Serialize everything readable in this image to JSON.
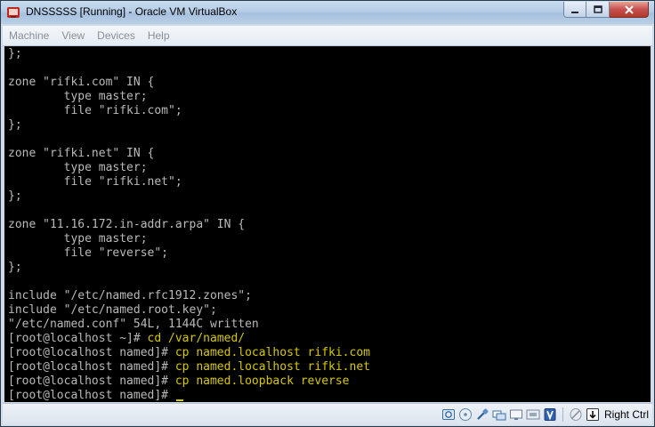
{
  "window": {
    "title": "DNSSSSS [Running] - Oracle VM VirtualBox"
  },
  "menu": {
    "items": [
      "Machine",
      "View",
      "Devices",
      "Help"
    ]
  },
  "terminal": {
    "lines": [
      {
        "type": "out",
        "text": "};"
      },
      {
        "type": "out",
        "text": ""
      },
      {
        "type": "out",
        "text": "zone \"rifki.com\" IN {"
      },
      {
        "type": "out",
        "text": "        type master;"
      },
      {
        "type": "out",
        "text": "        file \"rifki.com\";"
      },
      {
        "type": "out",
        "text": "};"
      },
      {
        "type": "out",
        "text": ""
      },
      {
        "type": "out",
        "text": "zone \"rifki.net\" IN {"
      },
      {
        "type": "out",
        "text": "        type master;"
      },
      {
        "type": "out",
        "text": "        file \"rifki.net\";"
      },
      {
        "type": "out",
        "text": "};"
      },
      {
        "type": "out",
        "text": ""
      },
      {
        "type": "out",
        "text": "zone \"11.16.172.in-addr.arpa\" IN {"
      },
      {
        "type": "out",
        "text": "        type master;"
      },
      {
        "type": "out",
        "text": "        file \"reverse\";"
      },
      {
        "type": "out",
        "text": "};"
      },
      {
        "type": "out",
        "text": ""
      },
      {
        "type": "out",
        "text": "include \"/etc/named.rfc1912.zones\";"
      },
      {
        "type": "out",
        "text": "include \"/etc/named.root.key\";"
      },
      {
        "type": "out",
        "text": "\"/etc/named.conf\" 54L, 1144C written"
      },
      {
        "type": "cmd",
        "prompt": "[root@localhost ~]# ",
        "command": "cd /var/named/"
      },
      {
        "type": "cmd",
        "prompt": "[root@localhost named]# ",
        "command": "cp named.localhost rifki.com"
      },
      {
        "type": "cmd",
        "prompt": "[root@localhost named]# ",
        "command": "cp named.localhost rifki.net"
      },
      {
        "type": "cmd",
        "prompt": "[root@localhost named]# ",
        "command": "cp named.loopback reverse"
      },
      {
        "type": "cmd",
        "prompt": "[root@localhost named]# ",
        "command": "",
        "cursor": true
      }
    ]
  },
  "statusbar": {
    "icons": [
      "hard-disk-icon",
      "optical-drive-icon",
      "usb-icon",
      "shared-folders-icon",
      "display-icon",
      "network-icon",
      "virtualization-icon",
      "mouse-integration-icon",
      "keyboard-icon"
    ],
    "host_key": "Right Ctrl"
  },
  "colors": {
    "terminal_bg": "#000000",
    "terminal_text": "#b9b9b9",
    "command_text": "#d6c700"
  }
}
